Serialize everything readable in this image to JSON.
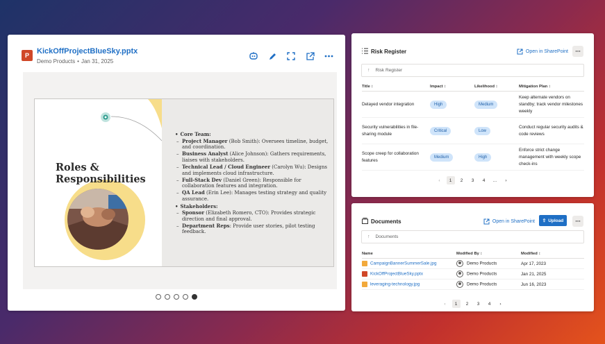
{
  "preview": {
    "file_icon_label": "P",
    "file_name": "KickOffProjectBlueSky.pptx",
    "site": "Demo Products",
    "separator": "•",
    "date": "Jan 31, 2025",
    "actions": [
      "copilot-icon",
      "pencil-icon",
      "expand-icon",
      "open-external-icon",
      "more-icon"
    ],
    "slide": {
      "title_line1": "Roles &",
      "title_line2": "Responsibilities",
      "sections": [
        {
          "heading": "Core Team:",
          "items": [
            {
              "role": "Project Manager",
              "desc": " (Bob Smith): Oversees timeline, budget, and coordination."
            },
            {
              "role": "Business Analyst",
              "desc": " (Alice Johnson): Gathers requirements, liaises with stakeholders."
            },
            {
              "role": "Technical Lead / Cloud Engineer",
              "desc": " (Carolyn Wu): Designs and implements cloud infrastructure."
            },
            {
              "role": "Full-Stack Dev",
              "desc": " (Daniel Green): Responsible for collaboration features and integration."
            },
            {
              "role": "QA Lead",
              "desc": " (Erin Lee): Manages testing strategy and quality assurance."
            }
          ]
        },
        {
          "heading": "Stakeholders:",
          "items": [
            {
              "role": "Sponsor",
              "desc": " (Elizabeth Romero, CTO): Provides strategic direction and final approval."
            },
            {
              "role": "Department Reps",
              "desc": ": Provide user stories, pilot testing feedback."
            }
          ]
        }
      ]
    },
    "slide_count": 5,
    "active_slide": 5
  },
  "risk": {
    "title": "Risk Register",
    "open_label": "Open in SharePoint",
    "breadcrumb": "Risk Register",
    "columns": [
      "Title",
      "Impact",
      "Likelihood",
      "Mitigation Plan"
    ],
    "rows": [
      {
        "title": "Delayed vendor integration",
        "impact": "High",
        "likelihood": "Medium",
        "mitigation": "Keep alternate vendors on standby; track vendor milestones weekly"
      },
      {
        "title": "Security vulnerabilities in file-sharing module",
        "impact": "Critical",
        "likelihood": "Low",
        "mitigation": "Conduct regular security audits & code reviews"
      },
      {
        "title": "Scope creep for collaboration features",
        "impact": "Medium",
        "likelihood": "High",
        "mitigation": "Enforce strict change management with weekly scope check-ins"
      }
    ],
    "pages": [
      "1",
      "2",
      "3",
      "4",
      "..."
    ],
    "current_page": "1"
  },
  "docs": {
    "title": "Documents",
    "open_label": "Open in SharePoint",
    "upload_label": "Upload",
    "breadcrumb": "Documents",
    "columns": [
      "Name",
      "Modified By",
      "Modified"
    ],
    "rows": [
      {
        "name": "CampaignBannerSummerSale.jpg",
        "type": "image",
        "by": "Demo Products",
        "date": "Apr 17, 2023"
      },
      {
        "name": "KickOffProjectBlueSky.pptx",
        "type": "pptx",
        "by": "Demo Products",
        "date": "Jan 21, 2025"
      },
      {
        "name": "leveraging-technology.jpg",
        "type": "image",
        "by": "Demo Products",
        "date": "Jun 16, 2023"
      }
    ],
    "pages": [
      "1",
      "2",
      "3",
      "4"
    ],
    "current_page": "1"
  },
  "colors": {
    "accent": "#1f6fc5",
    "ppt": "#d04727",
    "image_file": "#f2a93b",
    "pill_bg": "#cfe4fa"
  }
}
